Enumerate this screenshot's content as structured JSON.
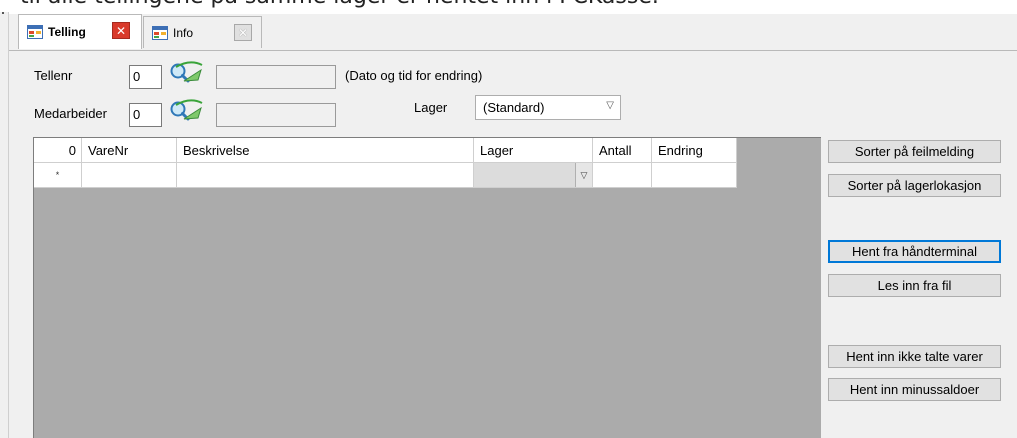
{
  "top_text": "til alle tellingene på samme lager er hentet inn i PCKasse.",
  "tabs": [
    {
      "label": "Telling",
      "active": true
    },
    {
      "label": "Info",
      "active": false
    }
  ],
  "form": {
    "tellenr_label": "Tellenr",
    "tellenr_value": "0",
    "tellenr_name": "",
    "date_label": "(Dato og tid for endring)",
    "medarbeider_label": "Medarbeider",
    "medarbeider_value": "0",
    "medarbeider_name": "",
    "lager_label": "Lager",
    "lager_selected": "(Standard)"
  },
  "grid": {
    "columns": [
      "0",
      "VareNr",
      "Beskrivelse",
      "Lager",
      "Antall",
      "Endring"
    ],
    "new_row_marker": "*"
  },
  "buttons": {
    "sort_error": "Sorter på feilmelding",
    "sort_location": "Sorter på lagerlokasjon",
    "fetch_terminal": "Hent fra håndterminal",
    "read_file": "Les inn fra fil",
    "fetch_uncounted": "Hent inn ikke talte varer",
    "fetch_negative": "Hent inn minussaldoer"
  },
  "icons": {
    "tab": "window-form-icon",
    "close": "close-x-icon",
    "lookup": "lookup-magnifier-icon"
  },
  "colors": {
    "close_active": "#d93a2b",
    "focus_border": "#0078d7",
    "grid_background": "#ababab"
  }
}
